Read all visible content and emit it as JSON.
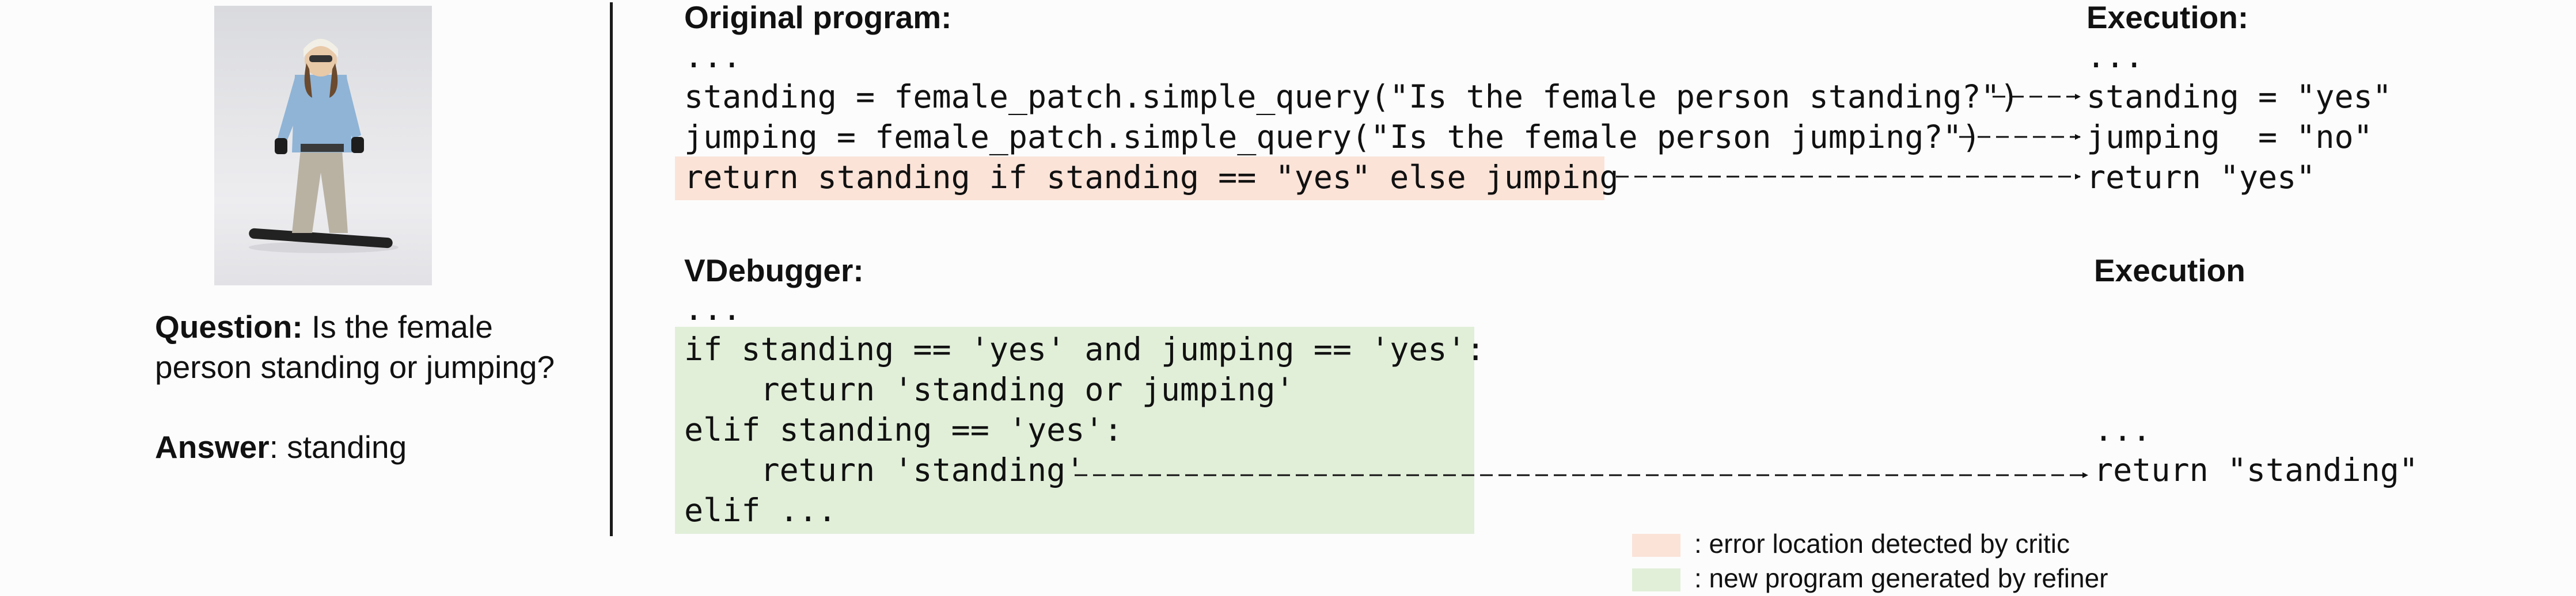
{
  "left_panel": {
    "image_alt": "woman snowboarding",
    "question_label": "Question:",
    "question_text": " Is the female person standing or jumping?",
    "answer_label": "Answer",
    "answer_text": ": standing"
  },
  "original_program": {
    "heading": "Original program:",
    "lines": [
      "...",
      "standing = female_patch.simple_query(\"Is the female person standing?\")",
      "jumping = female_patch.simple_query(\"Is the female person jumping?\")",
      "return standing if standing == \"yes\" else jumping"
    ]
  },
  "original_execution": {
    "heading": "Execution:",
    "lines": [
      "...",
      "standing = \"yes\"",
      "jumping  = \"no\"",
      "return \"yes\""
    ]
  },
  "vdebugger": {
    "heading": "VDebugger:",
    "lines": [
      "...",
      "if standing == 'yes' and jumping == 'yes':",
      "    return 'standing or jumping'",
      "elif standing == 'yes':",
      "    return 'standing'",
      "elif ..."
    ]
  },
  "vdebugger_execution": {
    "heading": "Execution",
    "lines": [
      "...",
      "return \"standing\""
    ]
  },
  "legend": {
    "items": [
      {
        "label": ": error location detected by critic",
        "color": "#fbe3d8"
      },
      {
        "label": ": new program generated by refiner",
        "color": "#e1efd9"
      }
    ]
  }
}
